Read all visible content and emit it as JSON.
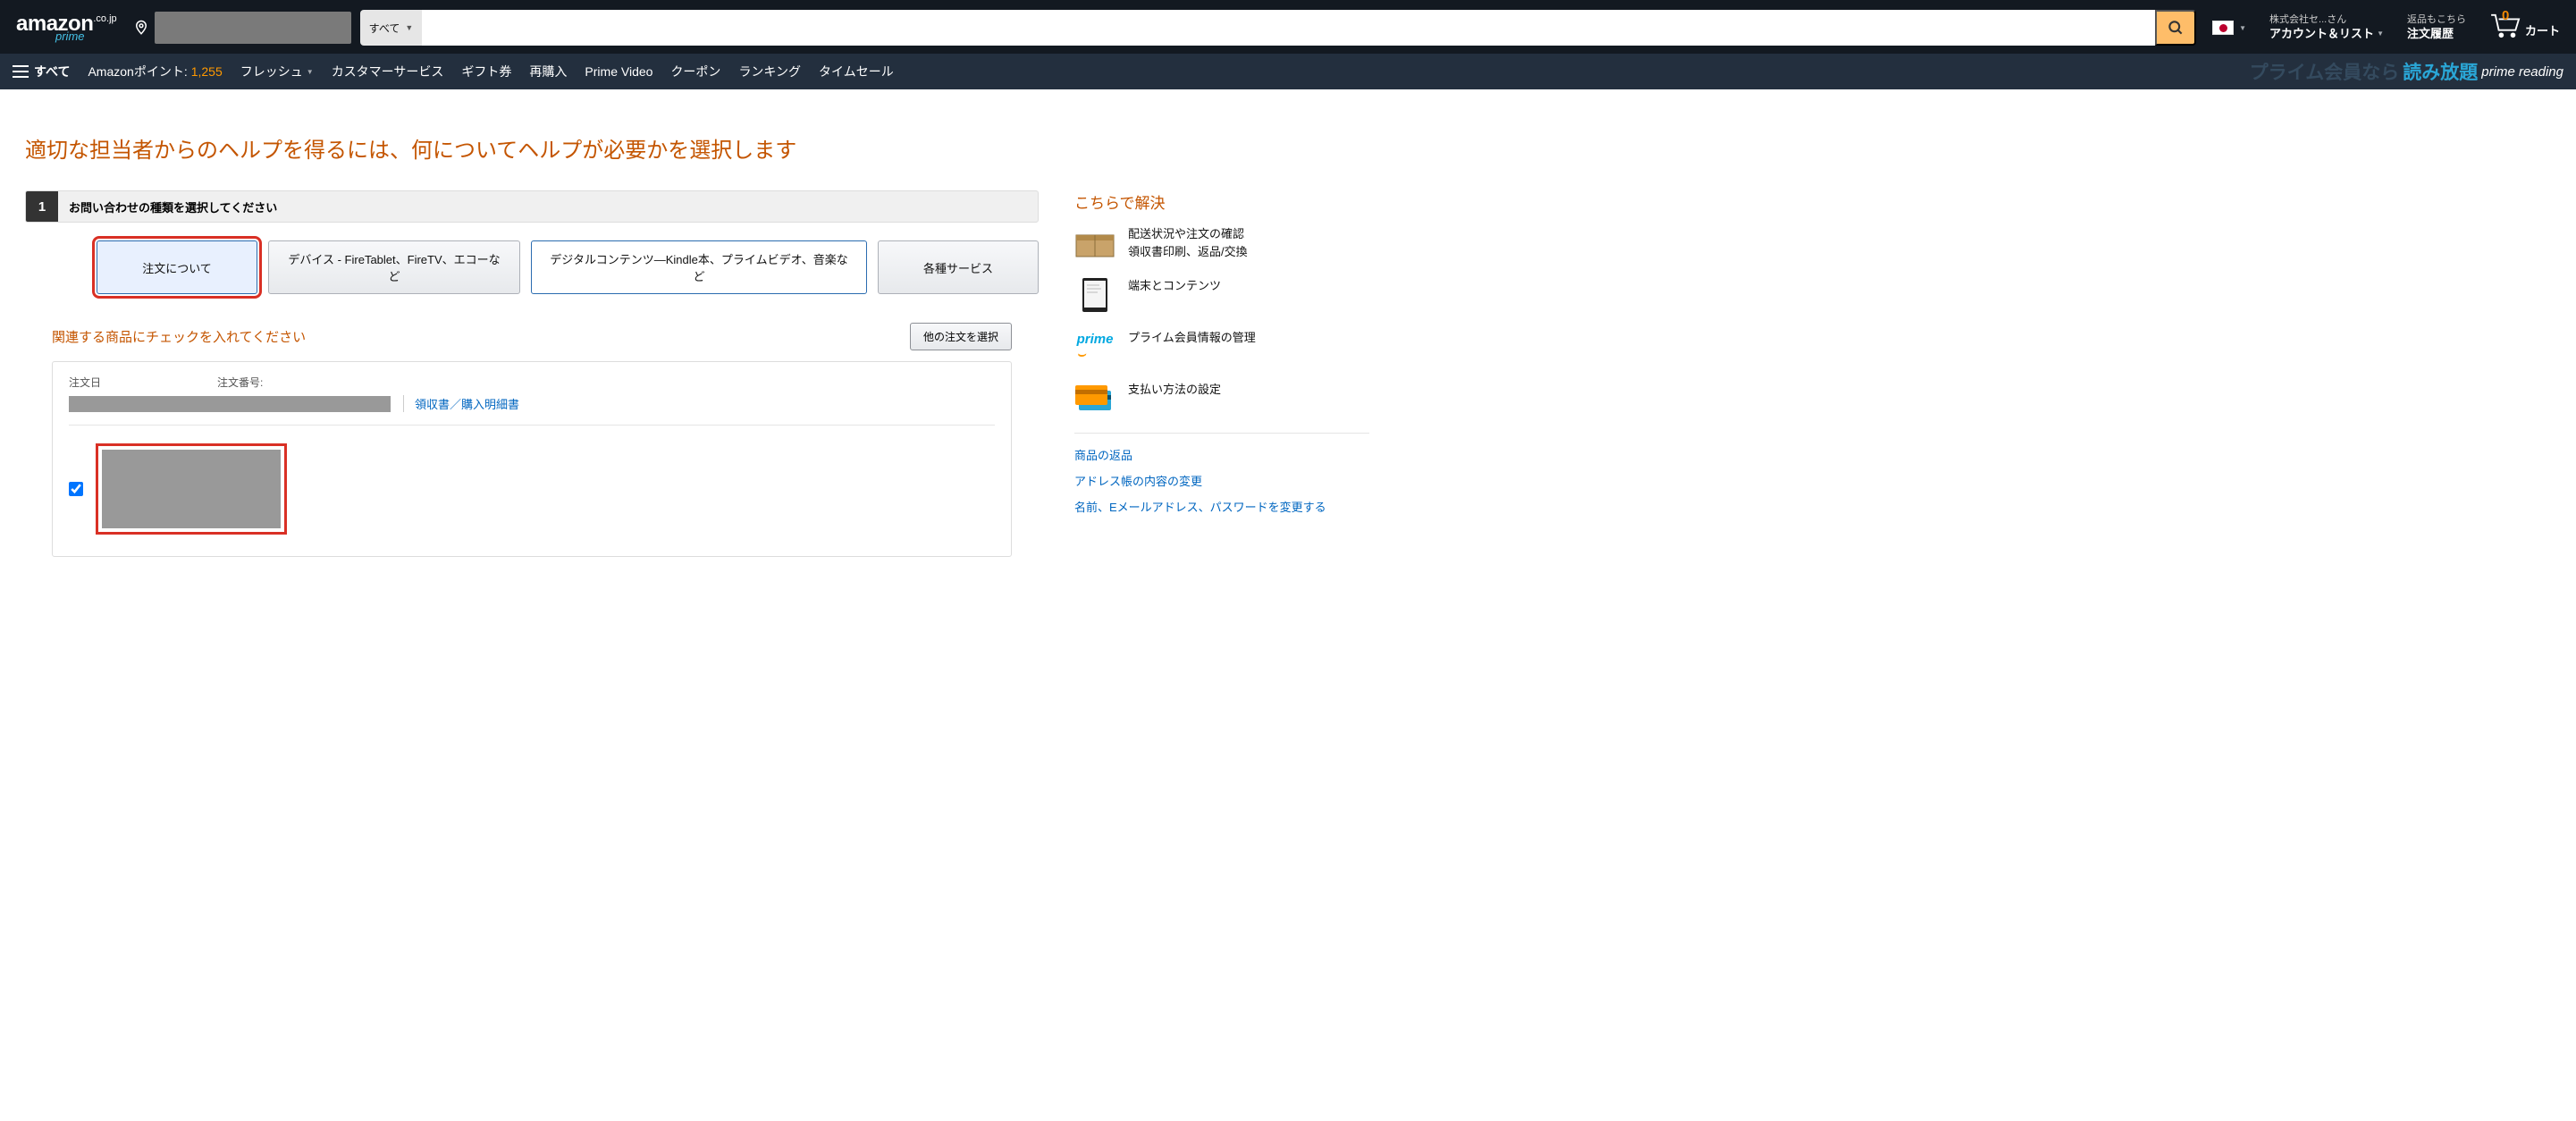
{
  "header": {
    "logo_main": "amazon",
    "logo_tld": ".co.jp",
    "logo_sub": "prime",
    "search_category": "すべて",
    "account_line1": "株式会社セ...さん",
    "account_line2": "アカウント＆リスト",
    "orders_line1": "返品もこちら",
    "orders_line2": "注文履歴",
    "cart_count": "0",
    "cart_label": "カート"
  },
  "subnav": {
    "all": "すべて",
    "points_label": "Amazonポイント:",
    "points_value": "1,255",
    "items": [
      "フレッシュ",
      "カスタマーサービス",
      "ギフト券",
      "再購入",
      "Prime Video",
      "クーポン",
      "ランキング",
      "タイムセール"
    ],
    "prime_banner_a": "プライム会員なら",
    "prime_banner_b": "読み放題",
    "prime_reading": "prime reading"
  },
  "page": {
    "title": "適切な担当者からのヘルプを得るには、何についてヘルプが必要かを選択します",
    "step_number": "1",
    "step_label": "お問い合わせの種類を選択してください",
    "tabs": [
      "注文について",
      "デバイス - FireTablet、FireTV、エコーなど",
      "デジタルコンテンツ―Kindle本、プライムビデオ、音楽など",
      "各種サービス"
    ],
    "sub_heading": "関連する商品にチェックを入れてください",
    "other_order_btn": "他の注文を選択",
    "order": {
      "date_label": "注文日",
      "number_label": "注文番号:",
      "receipt_link": "領収書／購入明細書"
    }
  },
  "sidebar": {
    "title": "こちらで解決",
    "help": [
      {
        "line1": "配送状況や注文の確認",
        "line2": "領収書印刷、返品/交換"
      },
      {
        "line1": "端末とコンテンツ",
        "line2": ""
      },
      {
        "line1": "プライム会員情報の管理",
        "line2": ""
      },
      {
        "line1": "支払い方法の設定",
        "line2": ""
      }
    ],
    "links": [
      "商品の返品",
      "アドレス帳の内容の変更",
      "名前、Eメールアドレス、パスワードを変更する"
    ]
  }
}
